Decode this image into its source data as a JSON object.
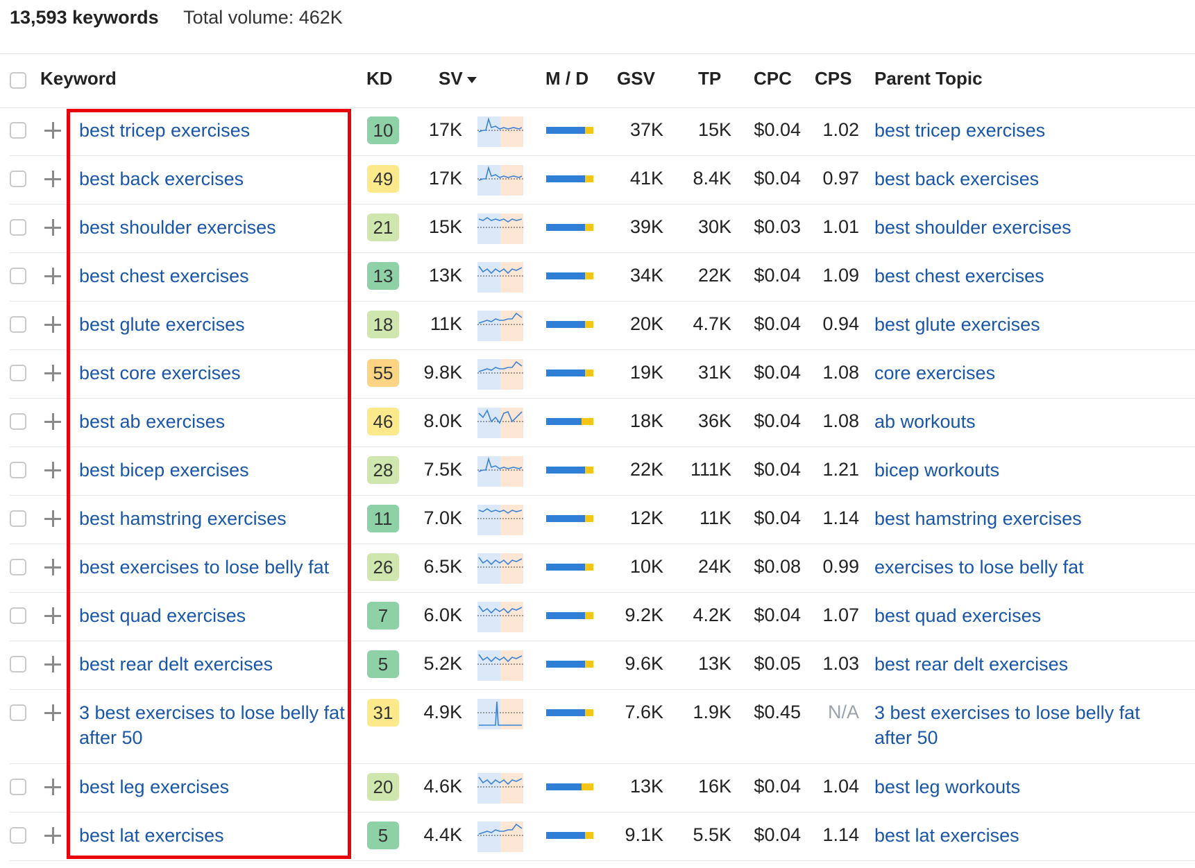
{
  "summary": {
    "count": "13,593 keywords",
    "volume": "Total volume: 462K"
  },
  "columns": {
    "keyword": "Keyword",
    "kd": "KD",
    "sv": "SV",
    "md": "M / D",
    "gsv": "GSV",
    "tp": "TP",
    "cpc": "CPC",
    "cps": "CPS",
    "parent": "Parent Topic"
  },
  "colors": {
    "link": "#1a56a8",
    "highlight": "#e8000b",
    "kd_green_dark": "#8fd1a6",
    "kd_green_light": "#cfe6ae",
    "kd_yellow": "#fbe98c",
    "kd_orange": "#fdd384"
  },
  "rows": [
    {
      "keyword": "best tricep exercises",
      "kd": "10",
      "sv": "17K",
      "md": 0.82,
      "gsv": "37K",
      "tp": "15K",
      "cpc": "$0.04",
      "cps": "1.02",
      "parent": "best tricep exercises",
      "trend": "spike-early"
    },
    {
      "keyword": "best back exercises",
      "kd": "49",
      "sv": "17K",
      "md": 0.82,
      "gsv": "41K",
      "tp": "8.4K",
      "cpc": "$0.04",
      "cps": "0.97",
      "parent": "best back exercises",
      "trend": "spike-early"
    },
    {
      "keyword": "best shoulder exercises",
      "kd": "21",
      "sv": "15K",
      "md": 0.82,
      "gsv": "39K",
      "tp": "30K",
      "cpc": "$0.03",
      "cps": "1.01",
      "parent": "best shoulder exercises",
      "trend": "flat-high"
    },
    {
      "keyword": "best chest exercises",
      "kd": "13",
      "sv": "13K",
      "md": 0.82,
      "gsv": "34K",
      "tp": "22K",
      "cpc": "$0.04",
      "cps": "1.09",
      "parent": "best chest exercises",
      "trend": "wavy"
    },
    {
      "keyword": "best glute exercises",
      "kd": "18",
      "sv": "11K",
      "md": 0.82,
      "gsv": "20K",
      "tp": "4.7K",
      "cpc": "$0.04",
      "cps": "0.94",
      "parent": "best glute exercises",
      "trend": "rise-late"
    },
    {
      "keyword": "best core exercises",
      "kd": "55",
      "sv": "9.8K",
      "md": 0.82,
      "gsv": "19K",
      "tp": "31K",
      "cpc": "$0.04",
      "cps": "1.08",
      "parent": "core exercises",
      "trend": "rise-late"
    },
    {
      "keyword": "best ab exercises",
      "kd": "46",
      "sv": "8.0K",
      "md": 0.75,
      "gsv": "18K",
      "tp": "36K",
      "cpc": "$0.04",
      "cps": "1.08",
      "parent": "ab workouts",
      "trend": "dip"
    },
    {
      "keyword": "best bicep exercises",
      "kd": "28",
      "sv": "7.5K",
      "md": 0.82,
      "gsv": "22K",
      "tp": "111K",
      "cpc": "$0.04",
      "cps": "1.21",
      "parent": "bicep workouts",
      "trend": "spike-early"
    },
    {
      "keyword": "best hamstring exercises",
      "kd": "11",
      "sv": "7.0K",
      "md": 0.82,
      "gsv": "12K",
      "tp": "11K",
      "cpc": "$0.04",
      "cps": "1.14",
      "parent": "best hamstring exercises",
      "trend": "flat-high"
    },
    {
      "keyword": "best exercises to lose belly fat",
      "kd": "26",
      "sv": "6.5K",
      "md": 0.82,
      "gsv": "10K",
      "tp": "24K",
      "cpc": "$0.08",
      "cps": "0.99",
      "parent": "exercises to lose belly fat",
      "trend": "wavy"
    },
    {
      "keyword": "best quad exercises",
      "kd": "7",
      "sv": "6.0K",
      "md": 0.82,
      "gsv": "9.2K",
      "tp": "4.2K",
      "cpc": "$0.04",
      "cps": "1.07",
      "parent": "best quad exercises",
      "trend": "wavy"
    },
    {
      "keyword": "best rear delt exercises",
      "kd": "5",
      "sv": "5.2K",
      "md": 0.82,
      "gsv": "9.6K",
      "tp": "13K",
      "cpc": "$0.05",
      "cps": "1.03",
      "parent": "best rear delt exercises",
      "trend": "wavy"
    },
    {
      "keyword": "3 best exercises to lose belly fat after 50",
      "kd": "31",
      "sv": "4.9K",
      "md": 0.82,
      "gsv": "7.6K",
      "tp": "1.9K",
      "cpc": "$0.45",
      "cps": "N/A",
      "parent": "3 best exercises to lose belly fat after 50",
      "trend": "single-spike"
    },
    {
      "keyword": "best leg exercises",
      "kd": "20",
      "sv": "4.6K",
      "md": 0.75,
      "gsv": "13K",
      "tp": "16K",
      "cpc": "$0.04",
      "cps": "1.04",
      "parent": "best leg workouts",
      "trend": "wavy"
    },
    {
      "keyword": "best lat exercises",
      "kd": "5",
      "sv": "4.4K",
      "md": 0.82,
      "gsv": "9.1K",
      "tp": "5.5K",
      "cpc": "$0.04",
      "cps": "1.14",
      "parent": "best lat exercises",
      "trend": "rise-late"
    }
  ]
}
